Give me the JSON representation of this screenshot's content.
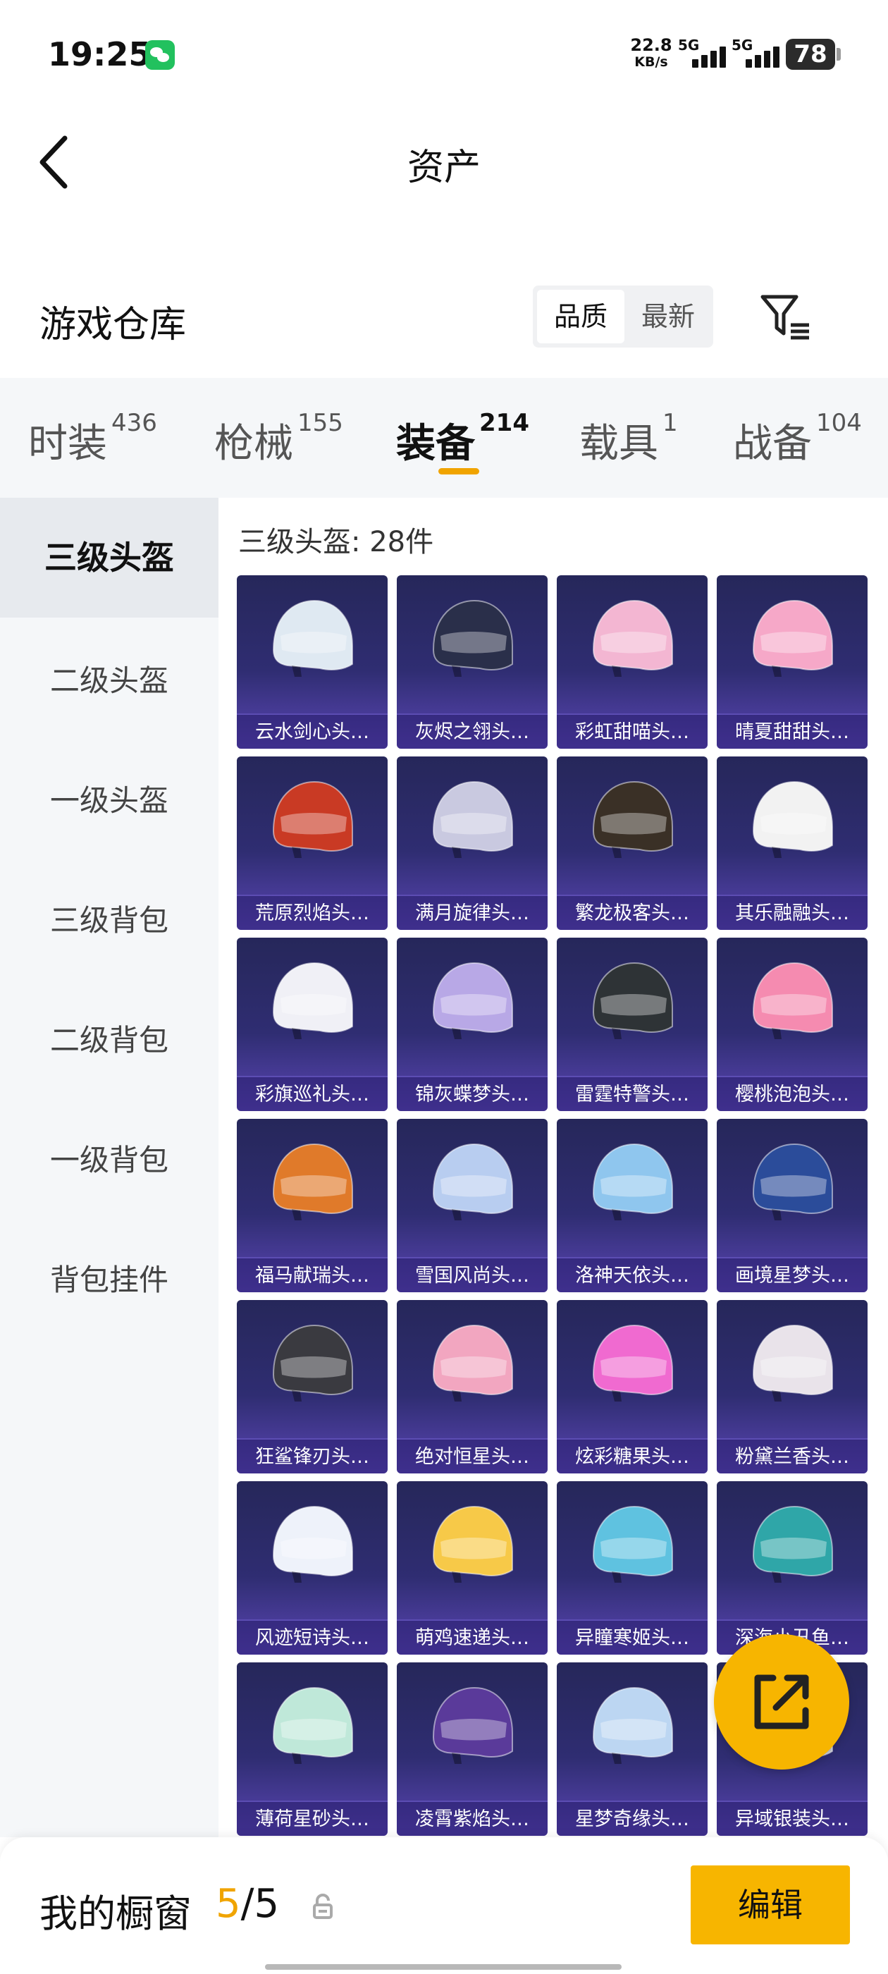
{
  "status_bar": {
    "time": "19:25",
    "app_icon": "wechat-icon",
    "net_speed_value": "22.8",
    "net_speed_unit": "KB/s",
    "signal_1": "5G",
    "signal_2": "5G",
    "battery": "78"
  },
  "header": {
    "back_icon": "chevron-left-icon",
    "title": "资产"
  },
  "warehouse": {
    "title": "游戏仓库",
    "sort_options": [
      "品质",
      "最新"
    ],
    "selected_sort": "品质",
    "filter_icon": "filter-icon"
  },
  "tabs": [
    {
      "label": "时装",
      "count": "436"
    },
    {
      "label": "枪械",
      "count": "155"
    },
    {
      "label": "装备",
      "count": "214",
      "active": true
    },
    {
      "label": "载具",
      "count": "1"
    },
    {
      "label": "战备",
      "count": "104"
    }
  ],
  "sidebar": {
    "items": [
      "三级头盔",
      "二级头盔",
      "一级头盔",
      "三级背包",
      "二级背包",
      "一级背包",
      "背包挂件"
    ],
    "active": "三级头盔"
  },
  "content": {
    "count_label": "三级头盔: 28件",
    "items": [
      {
        "name": "云水剑心头…",
        "color": "#dfe9f2"
      },
      {
        "name": "灰烬之翎头…",
        "color": "#2a2f4a"
      },
      {
        "name": "彩虹甜喵头…",
        "color": "#f3b6d2"
      },
      {
        "name": "晴夏甜甜头…",
        "color": "#f6a8c8"
      },
      {
        "name": "荒原烈焰头…",
        "color": "#c93a24"
      },
      {
        "name": "满月旋律头…",
        "color": "#c9c9e0"
      },
      {
        "name": "繁龙极客头…",
        "color": "#3a3026"
      },
      {
        "name": "其乐融融头…",
        "color": "#f2f2f2"
      },
      {
        "name": "彩旗巡礼头…",
        "color": "#f0f0f6"
      },
      {
        "name": "锦灰蝶梦头…",
        "color": "#b8a8e6"
      },
      {
        "name": "雷霆特警头…",
        "color": "#2e3336"
      },
      {
        "name": "樱桃泡泡头…",
        "color": "#f58bb0"
      },
      {
        "name": "福马献瑞头…",
        "color": "#e07a2a"
      },
      {
        "name": "雪国风尚头…",
        "color": "#b8cdf0"
      },
      {
        "name": "洛神天依头…",
        "color": "#8fc6ee"
      },
      {
        "name": "画境星梦头…",
        "color": "#2b4c9a"
      },
      {
        "name": "狂鲨锋刃头…",
        "color": "#3a3a40"
      },
      {
        "name": "绝对恒星头…",
        "color": "#f2a6c0"
      },
      {
        "name": "炫彩糖果头…",
        "color": "#f06ad0"
      },
      {
        "name": "粉黛兰香头…",
        "color": "#e9e3ea"
      },
      {
        "name": "风迹短诗头…",
        "color": "#eef2fa"
      },
      {
        "name": "萌鸡速递头…",
        "color": "#f7c948"
      },
      {
        "name": "异瞳寒姬头…",
        "color": "#5fc2e0"
      },
      {
        "name": "深海小丑鱼…",
        "color": "#2fa6a8"
      },
      {
        "name": "薄荷星砂头…",
        "color": "#bfe8d9"
      },
      {
        "name": "凌霄紫焰头…",
        "color": "#5a3a9a"
      },
      {
        "name": "星梦奇缘头…",
        "color": "#bcd6f2"
      },
      {
        "name": "异域银装头…",
        "color": "#c8ccd6"
      }
    ]
  },
  "share_fab_icon": "share-external-icon",
  "bottom_bar": {
    "label": "我的橱窗",
    "count_current": "5",
    "count_total": "/5",
    "lock_icon": "lock-icon",
    "edit_label": "编辑"
  }
}
